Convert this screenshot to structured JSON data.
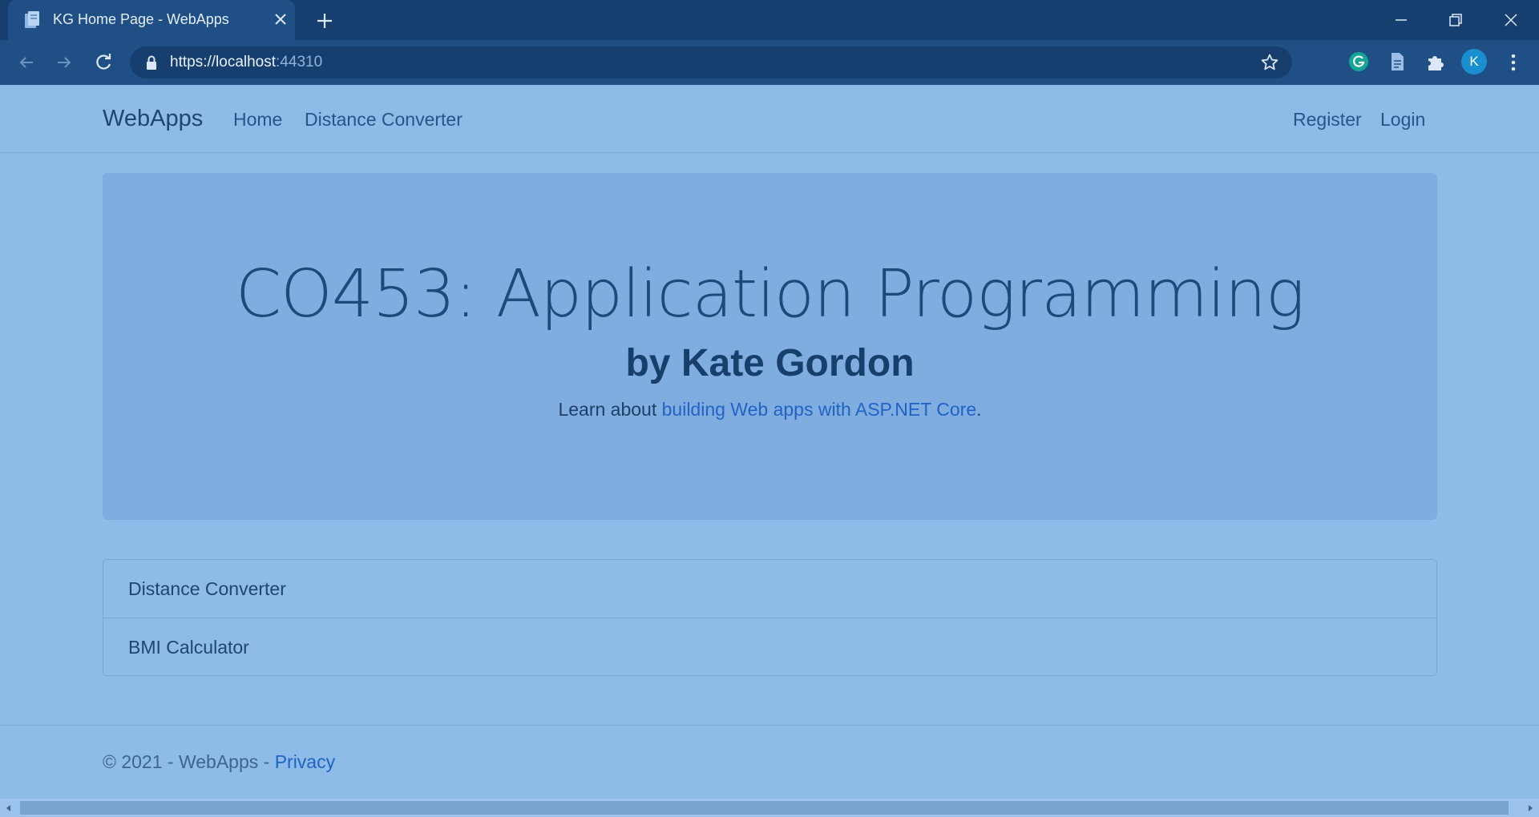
{
  "browser": {
    "tab_title": "KG Home Page - WebApps",
    "url_main": "https://localhost",
    "url_port": ":44310",
    "profile_initial": "K"
  },
  "navbar": {
    "brand": "WebApps",
    "links": [
      "Home",
      "Distance Converter"
    ],
    "right_links": [
      "Register",
      "Login"
    ]
  },
  "jumbotron": {
    "title": "CO453: Application Programming",
    "subtitle": "by Kate Gordon",
    "lead_prefix": "Learn about ",
    "lead_link": "building Web apps with ASP.NET Core",
    "lead_suffix": "."
  },
  "apps_list": [
    "Distance Converter",
    "BMI Calculator"
  ],
  "footer": {
    "text": "© 2021 - WebApps - ",
    "privacy": "Privacy"
  },
  "colors": {
    "chrome_dark": "#163f70",
    "chrome_toolbar": "#1f4f85",
    "page_bg": "#8fbbe8",
    "jumbotron_bg": "#80ade0",
    "link": "#1f63c4"
  }
}
